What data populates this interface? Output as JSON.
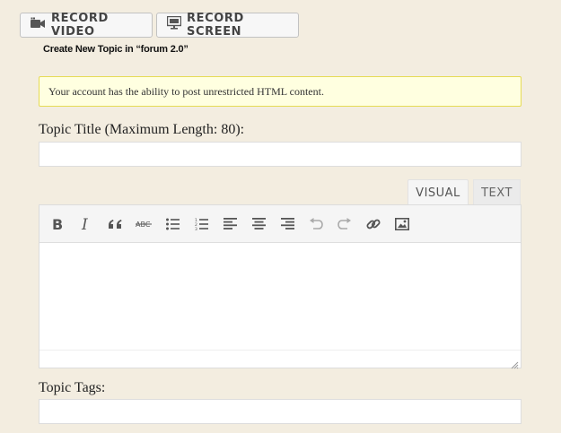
{
  "record": {
    "video_label": "RECORD VIDEO",
    "screen_label": "RECORD SCREEN",
    "video_icon": "video-camera-icon",
    "screen_icon": "monitor-icon"
  },
  "form": {
    "heading": "Create New Topic in “forum 2.0”",
    "notice": "Your account has the ability to post unrestricted HTML content.",
    "title_label": "Topic Title (Maximum Length: 80):",
    "title_value": "",
    "tags_label": "Topic Tags:",
    "tags_value": ""
  },
  "editor": {
    "tabs": [
      {
        "label": "VISUAL",
        "active": true
      },
      {
        "label": "TEXT",
        "active": false
      }
    ],
    "toolbar": [
      {
        "name": "bold",
        "icon": "bold-icon"
      },
      {
        "name": "italic",
        "icon": "italic-icon"
      },
      {
        "name": "blockquote",
        "icon": "quote-icon"
      },
      {
        "name": "strikethrough",
        "icon": "strikethrough-icon"
      },
      {
        "name": "bulleted-list",
        "icon": "bulleted-list-icon"
      },
      {
        "name": "numbered-list",
        "icon": "numbered-list-icon"
      },
      {
        "name": "align-left",
        "icon": "align-left-icon"
      },
      {
        "name": "align-center",
        "icon": "align-center-icon"
      },
      {
        "name": "align-right",
        "icon": "align-right-icon"
      },
      {
        "name": "undo",
        "icon": "undo-icon"
      },
      {
        "name": "redo",
        "icon": "redo-icon"
      },
      {
        "name": "insert-link",
        "icon": "link-icon"
      },
      {
        "name": "insert-image",
        "icon": "image-icon"
      }
    ],
    "content": ""
  },
  "colors": {
    "page_bg": "#f3ede0",
    "notice_bg": "#ffffe0",
    "notice_border": "#e6db55"
  }
}
